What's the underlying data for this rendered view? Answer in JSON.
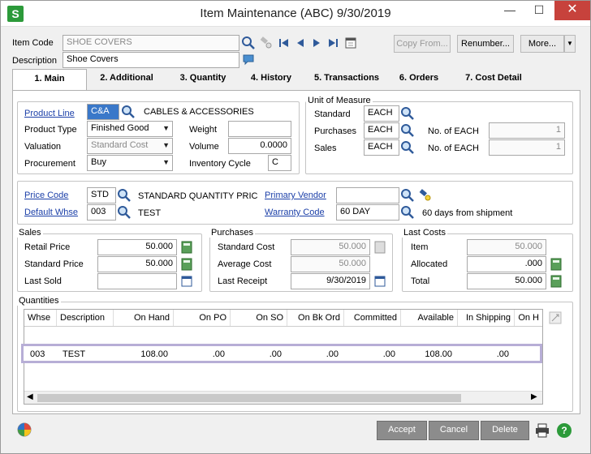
{
  "window": {
    "title": "Item Maintenance (ABC) 9/30/2019",
    "app_icon": "S"
  },
  "header": {
    "item_code_label": "Item Code",
    "item_code_value": "SHOE COVERS",
    "description_label": "Description",
    "description_value": "Shoe Covers",
    "copy_from": "Copy From...",
    "renumber": "Renumber...",
    "more": "More..."
  },
  "tabs": [
    "1. Main",
    "2. Additional",
    "3. Quantity",
    "4. History",
    "5. Transactions",
    "6. Orders",
    "7. Cost Detail"
  ],
  "main": {
    "product_line_label": "Product Line",
    "product_line_value": "C&A",
    "product_line_desc": "CABLES & ACCESSORIES",
    "product_type_label": "Product Type",
    "product_type_value": "Finished Good",
    "valuation_label": "Valuation",
    "valuation_value": "Standard Cost",
    "procurement_label": "Procurement",
    "procurement_value": "Buy",
    "weight_label": "Weight",
    "weight_value": "",
    "volume_label": "Volume",
    "volume_value": "0.0000",
    "inventory_cycle_label": "Inventory Cycle",
    "inventory_cycle_value": "C"
  },
  "uom": {
    "title": "Unit of Measure",
    "standard_label": "Standard",
    "standard_value": "EACH",
    "purchases_label": "Purchases",
    "purchases_value": "EACH",
    "sales_label": "Sales",
    "sales_value": "EACH",
    "no_of_each_label": "No. of EACH",
    "purchases_qty": "1",
    "sales_qty": "1"
  },
  "pricing": {
    "price_code_label": "Price Code",
    "price_code_value": "STD",
    "price_code_desc": "STANDARD QUANTITY PRICING",
    "default_whse_label": "Default Whse",
    "default_whse_value": "003",
    "default_whse_desc": "TEST",
    "primary_vendor_label": "Primary Vendor",
    "primary_vendor_value": "",
    "warranty_code_label": "Warranty Code",
    "warranty_code_value": "60 DAY",
    "warranty_desc": "60 days from shipment"
  },
  "sales": {
    "title": "Sales",
    "retail_label": "Retail Price",
    "retail_value": "50.000",
    "standard_label": "Standard Price",
    "standard_value": "50.000",
    "last_sold_label": "Last Sold",
    "last_sold_value": ""
  },
  "purchases": {
    "title": "Purchases",
    "standard_cost_label": "Standard Cost",
    "standard_cost_value": "50.000",
    "average_cost_label": "Average Cost",
    "average_cost_value": "50.000",
    "last_receipt_label": "Last Receipt",
    "last_receipt_value": "9/30/2019"
  },
  "last_costs": {
    "title": "Last Costs",
    "item_label": "Item",
    "item_value": "50.000",
    "allocated_label": "Allocated",
    "allocated_value": ".000",
    "total_label": "Total",
    "total_value": "50.000"
  },
  "quantities": {
    "title": "Quantities",
    "columns": [
      "Whse",
      "Description",
      "On Hand",
      "On PO",
      "On SO",
      "On Bk Ord",
      "Committed",
      "Available",
      "In Shipping",
      "On H"
    ],
    "row": [
      "003",
      "TEST",
      "108.00",
      ".00",
      ".00",
      ".00",
      ".00",
      "108.00",
      ".00"
    ]
  },
  "footer": {
    "accept": "Accept",
    "cancel": "Cancel",
    "delete": "Delete"
  },
  "colors": {
    "accent_link": "#1b3fa8",
    "close_red": "#c7423c",
    "app_green": "#2c9a3a",
    "row_highlight": "#b7aed6"
  }
}
